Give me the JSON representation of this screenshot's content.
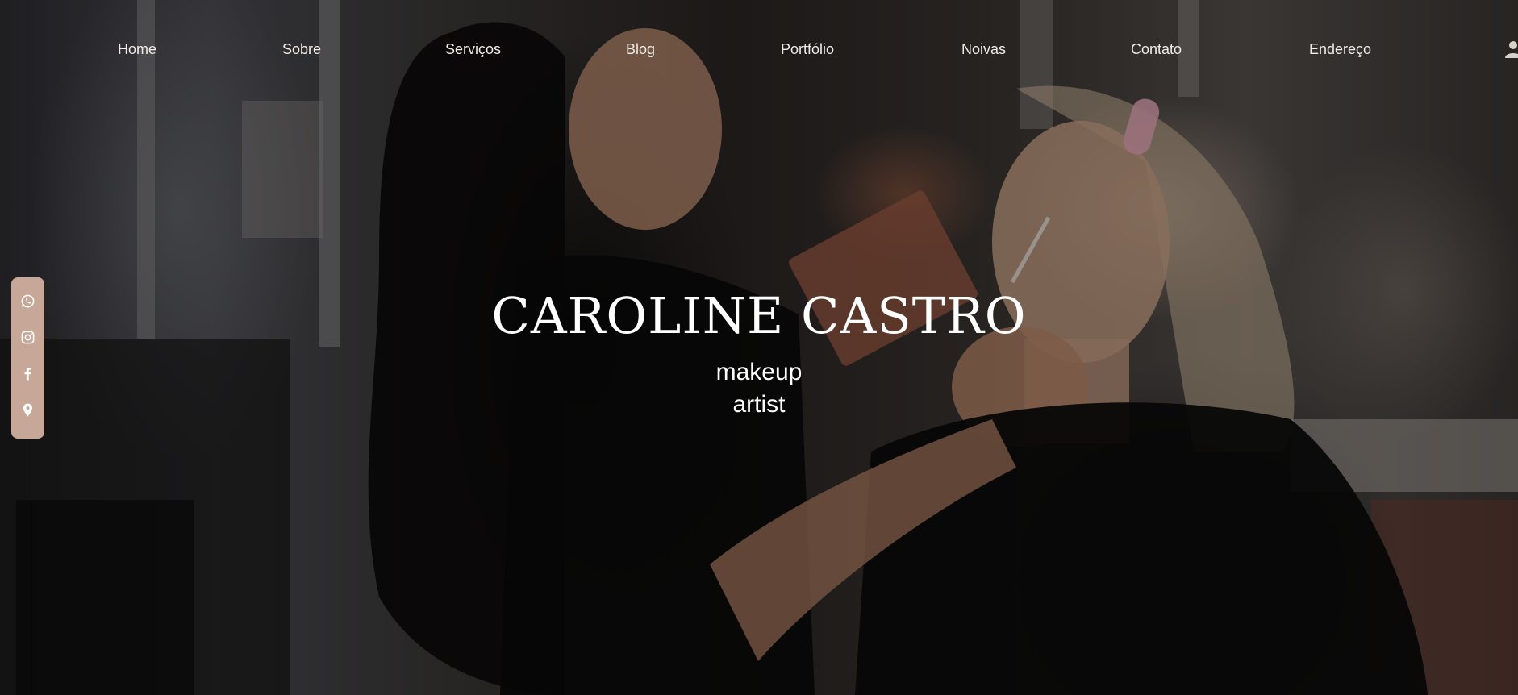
{
  "nav": {
    "items": [
      {
        "label": "Home"
      },
      {
        "label": "Sobre"
      },
      {
        "label": "Serviços"
      },
      {
        "label": "Blog"
      },
      {
        "label": "Portfólio"
      },
      {
        "label": "Noivas"
      },
      {
        "label": "Contato"
      },
      {
        "label": "Endereço"
      }
    ],
    "account_icon": "user-icon"
  },
  "social": {
    "background_color": "#c7a898",
    "icons": [
      "whatsapp-icon",
      "instagram-icon",
      "facebook-icon",
      "location-pin-icon"
    ]
  },
  "hero": {
    "title": "CAROLINE CASTRO",
    "subtitle_line1": "makeup",
    "subtitle_line2": "artist"
  }
}
